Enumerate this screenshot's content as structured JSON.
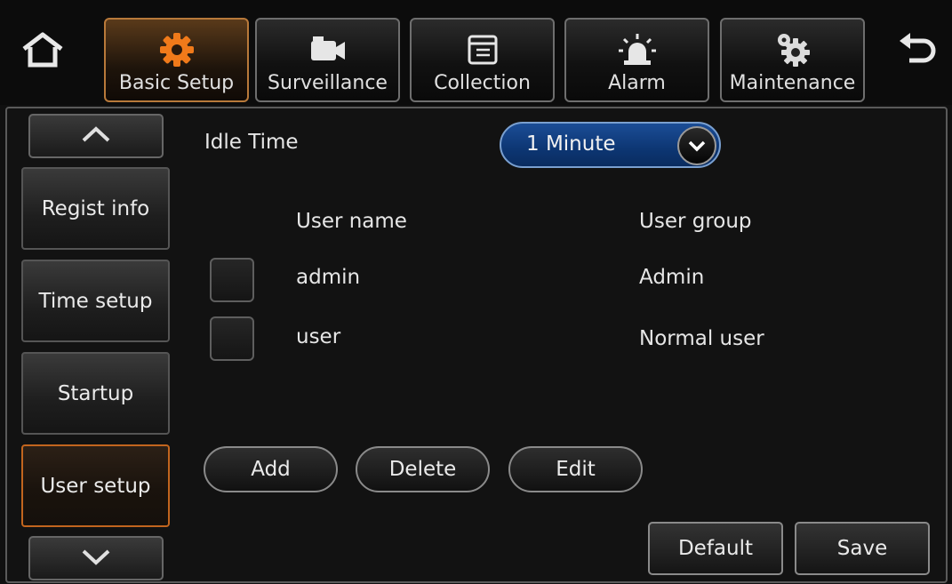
{
  "nav": {
    "home_icon": "home-icon",
    "back_icon": "back-arrow-icon",
    "tabs": [
      {
        "label": "Basic Setup",
        "icon": "gear-icon",
        "active": true
      },
      {
        "label": "Surveillance",
        "icon": "camera-icon",
        "active": false
      },
      {
        "label": "Collection",
        "icon": "folder-icon",
        "active": false
      },
      {
        "label": "Alarm",
        "icon": "siren-icon",
        "active": false
      },
      {
        "label": "Maintenance",
        "icon": "gears-icon",
        "active": false
      }
    ]
  },
  "sidebar": {
    "up_icon": "chevron-up-icon",
    "down_icon": "chevron-down-icon",
    "items": [
      {
        "label": "Regist info"
      },
      {
        "label": "Time setup"
      },
      {
        "label": "Startup"
      },
      {
        "label": "User setup",
        "active": true
      }
    ]
  },
  "form": {
    "idle_time_label": "Idle Time",
    "idle_time_value": "1 Minute",
    "col_user_name": "User name",
    "col_user_group": "User group",
    "users": [
      {
        "name": "admin",
        "group": "Admin"
      },
      {
        "name": "user",
        "group": "Normal user"
      }
    ]
  },
  "actions": {
    "add": "Add",
    "delete": "Delete",
    "edit": "Edit",
    "default": "Default",
    "save": "Save"
  },
  "colors": {
    "accent": "#c2651e",
    "dropdown": "#0d3673",
    "gear": "#f07a1a"
  }
}
